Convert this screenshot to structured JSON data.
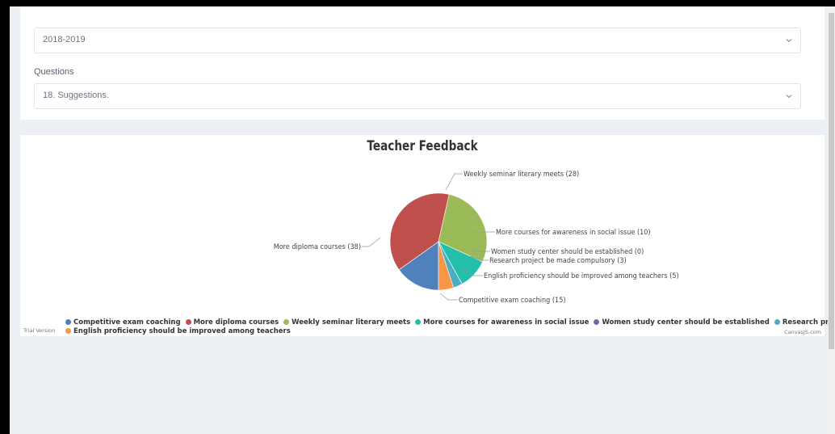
{
  "filters": {
    "year_value": "2018-2019",
    "questions_label": "Questions",
    "question_value": "18. Suggestions."
  },
  "chart_data": {
    "type": "pie",
    "title": "Teacher Feedback",
    "slices": [
      {
        "label": "Competitive exam coaching",
        "value": 15,
        "color": "#4F81BC"
      },
      {
        "label": "More diploma courses",
        "value": 38,
        "color": "#C0504E"
      },
      {
        "label": "Weekly seminar literary meets",
        "value": 28,
        "color": "#9BBB58"
      },
      {
        "label": "More courses for awareness in social issue",
        "value": 10,
        "color": "#23BFAA"
      },
      {
        "label": "Women study center should be established",
        "value": 0,
        "color": "#8064A1"
      },
      {
        "label": "Research project be made compulsory",
        "value": 3,
        "color": "#4AACC5"
      },
      {
        "label": "English proficiency should be improved among teachers",
        "value": 5,
        "color": "#F79647"
      }
    ],
    "legend_position": "bottom"
  },
  "chart_labels": {
    "competitive": "Competitive exam coaching (15)",
    "diploma": "More diploma courses (38)",
    "weekly": "Weekly seminar literary meets (28)",
    "awareness": "More courses for awareness in social issue (10)",
    "women": "Women study center should be established (0)",
    "research": "Research project be made compulsory (3)",
    "english": "English proficiency should be improved among teachers (5)"
  },
  "legend": {
    "row1": [
      "Competitive exam coaching",
      "More diploma courses",
      "Weekly seminar literary meets",
      "More courses for awareness in social issue",
      "Women study center should be established",
      "Research project be made compulsory"
    ],
    "row2": [
      "English proficiency should be improved among teachers"
    ]
  },
  "footer": {
    "trial": "Trial Version",
    "credit": "CanvasJS.com"
  }
}
